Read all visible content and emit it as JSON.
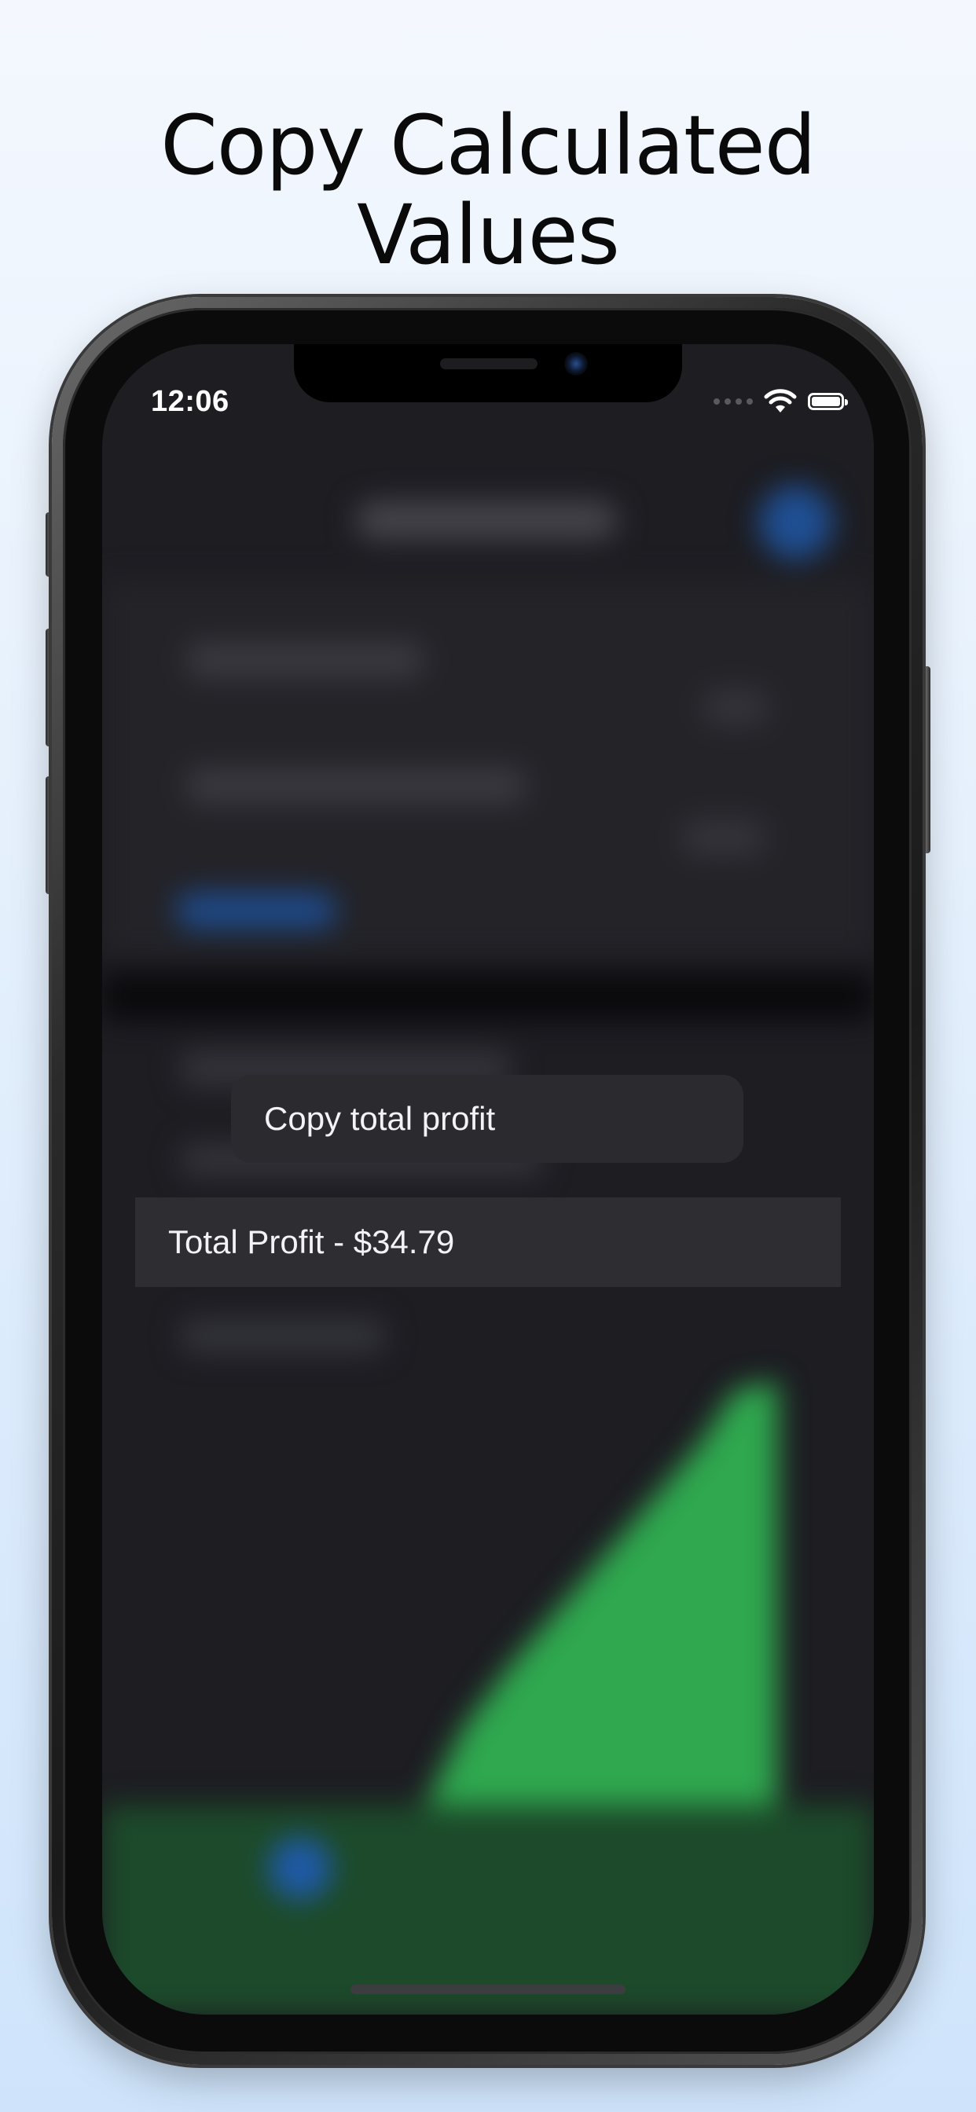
{
  "headline": {
    "line1": "Copy Calculated",
    "line2": "Values"
  },
  "status_bar": {
    "time": "12:06",
    "icons": [
      "signal-dots-icon",
      "wifi-icon",
      "battery-icon"
    ]
  },
  "context_menu": {
    "items": [
      {
        "label": "Copy total profit"
      }
    ]
  },
  "selected_row": {
    "label": "Total Profit - $34.79"
  },
  "colors": {
    "background_top": "#f4f8fe",
    "background_bottom": "#cfe4fb",
    "screen_bg": "#1d1d22",
    "menu_bg": "#2b2b2f",
    "row_bg": "#2e2e32",
    "chart_green": "#2fa84f",
    "accent_blue": "#1e5aa8"
  }
}
